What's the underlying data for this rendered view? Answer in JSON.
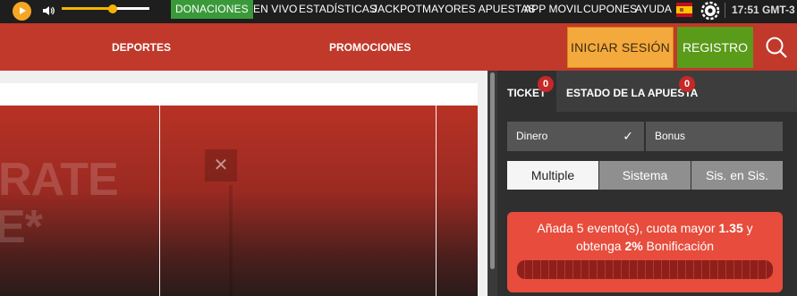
{
  "topbar": {
    "nav": [
      "DONACIONES",
      "EN VIVO",
      "ESTADÍSTICAS",
      "JACKPOT",
      "MAYORES APUESTAS",
      "APP MOVIL",
      "CUPONES",
      "AYUDA"
    ],
    "volume_level": 0.58,
    "clock": "17:51 GMT-3"
  },
  "header": {
    "links": [
      "DEPORTES",
      "PROMOCIONES"
    ],
    "login_label": "INICIAR SESIÓN",
    "register_label": "REGISTRO"
  },
  "banner": {
    "line1": "RATE",
    "line2": "E*"
  },
  "ticket": {
    "tab_ticket": "TICKET",
    "tab_ticket_count": "0",
    "tab_status": "ESTADO DE LA APUESTA",
    "tab_status_count": "0",
    "money_label": "Dinero",
    "bonus_label": "Bonus",
    "modes": [
      "Multiple",
      "Sistema",
      "Sis. en Sis."
    ],
    "promo_line1_pre": "Añada 5 evento(s), cuota mayor ",
    "promo_odds": "1.35",
    "promo_line1_post": " y",
    "promo_line2_pre": "obtenga ",
    "promo_pct": "2%",
    "promo_line2_post": " Bonificación"
  },
  "colors": {
    "accent_active": "#3a9a3a",
    "header_red": "#c0392b",
    "login": "#f4a93d",
    "register": "#5a9b1a",
    "promo": "#e74c3c"
  }
}
